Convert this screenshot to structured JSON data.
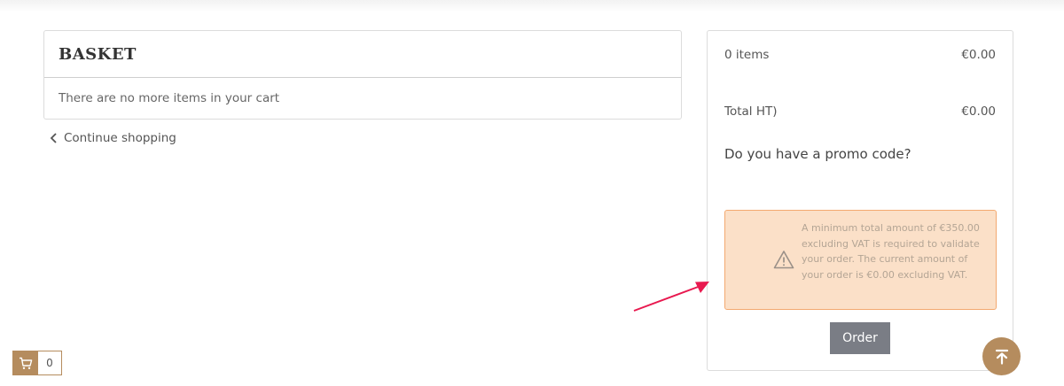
{
  "basket": {
    "title": "BASKET",
    "empty_message": "There are no more items in your cart"
  },
  "continue_shopping": {
    "label": "Continue shopping",
    "icon": "chevron-left-icon"
  },
  "summary": {
    "items_label": "0 items",
    "items_value": "€0.00",
    "total_label": "Total HT)",
    "total_value": "€0.00",
    "promo_label": "Do you have a promo code?",
    "alert": {
      "icon": "warning-triangle-icon",
      "text": "A minimum total amount of €350.00 excluding VAT is required to validate your order. The current amount of your order is €0.00 excluding VAT."
    },
    "order_button": "Order"
  },
  "cart_widget": {
    "icon": "cart-icon",
    "count": "0"
  },
  "scroll_top": {
    "icon": "arrow-up-to-top-icon"
  },
  "colors": {
    "accent": "#b58c5e",
    "alert_bg": "#fbe0c8",
    "alert_border": "#f3a970",
    "order_button": "#7a7d85",
    "annotation_arrow": "#e8194f"
  }
}
